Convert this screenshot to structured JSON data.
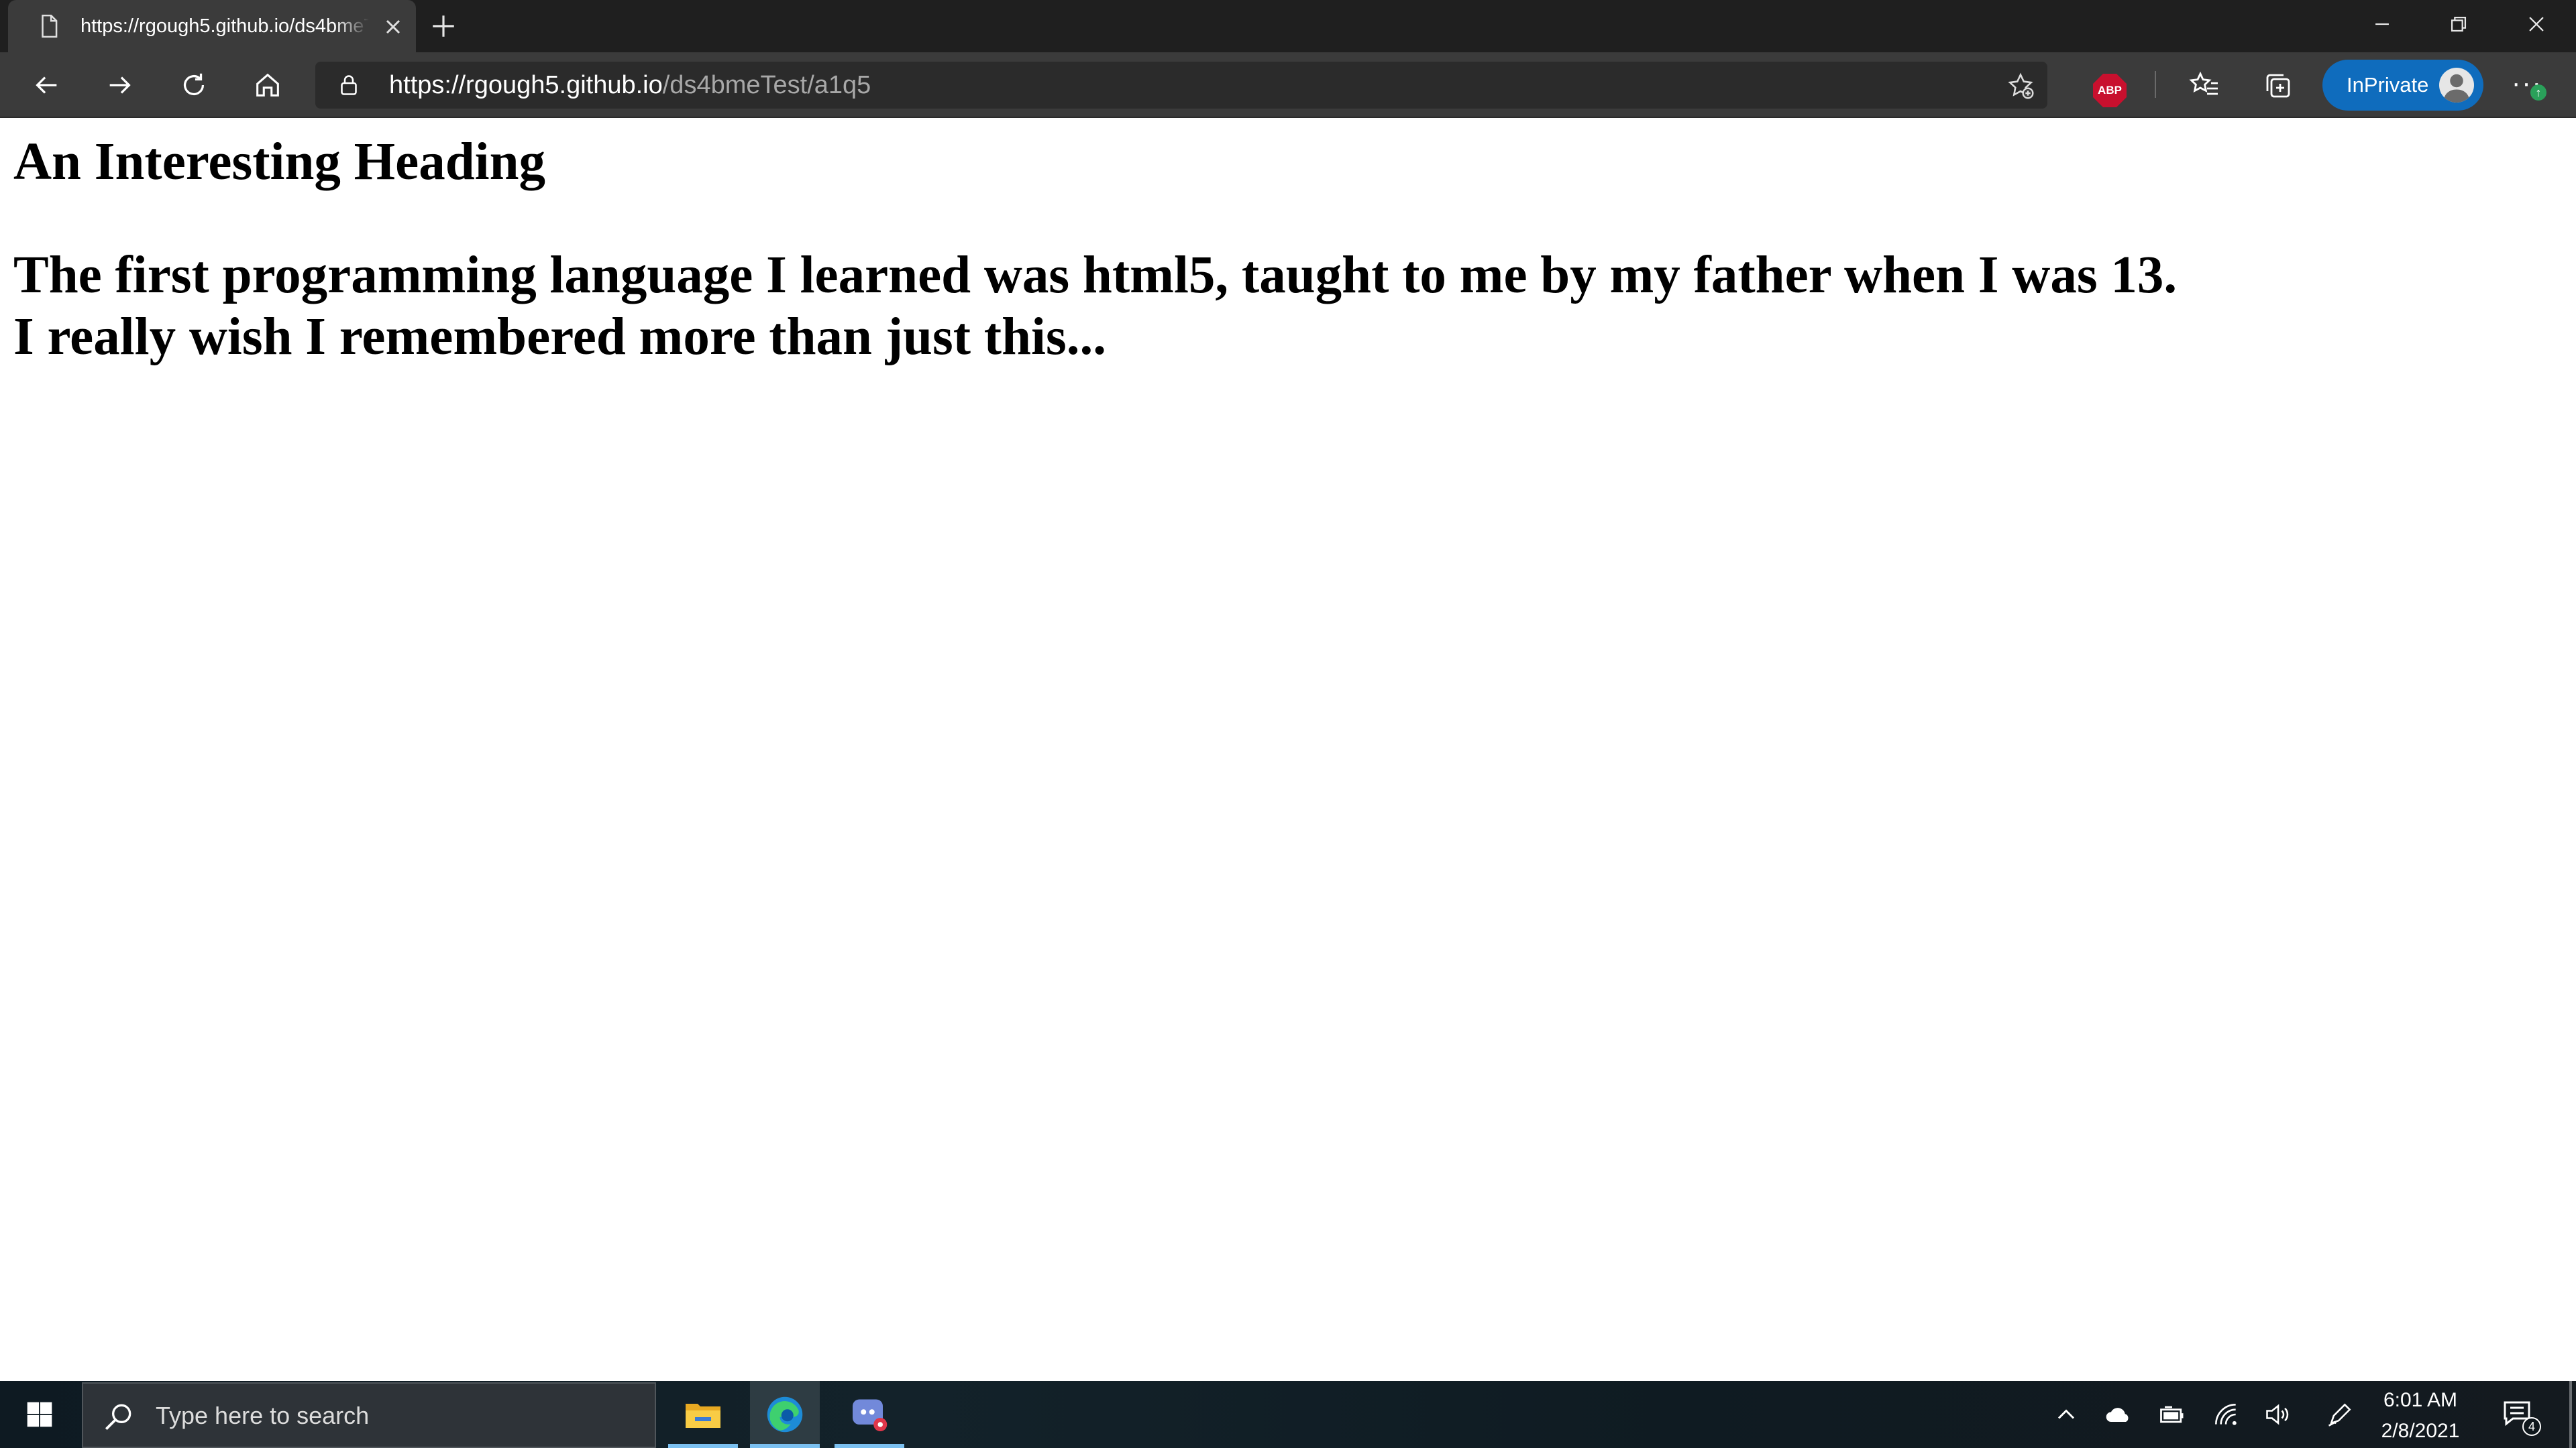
{
  "browser": {
    "tab": {
      "title": "https://rgough5.github.io/ds4bmeTest/a1q5",
      "favicon": "page-icon",
      "close_icon": "close-icon"
    },
    "new_tab_icon": "plus-icon",
    "window_controls": [
      "minimize-icon",
      "restore-icon",
      "close-icon"
    ],
    "address_bar": {
      "host": "https://rgough5.github.io",
      "path": "/ds4bmeTest/a1q5",
      "lock_icon": "lock-icon"
    },
    "nav_icons": [
      "back-icon",
      "forward-icon",
      "refresh-icon",
      "home-icon"
    ],
    "extensions": {
      "abp_label": "ABP"
    },
    "inprivate_label": "InPrivate",
    "menu_badge": "↑"
  },
  "page": {
    "heading": "An Interesting Heading",
    "subheading_line1": "The first programming language I learned was html5, taught to me by my father when I was 13.",
    "subheading_line2": "I really wish I remembered more than just this..."
  },
  "taskbar": {
    "search_placeholder": "Type here to search",
    "apps": [
      "file-explorer-icon",
      "edge-icon",
      "app-icon"
    ],
    "tray_icons": [
      "chevron-up-icon",
      "onedrive-icon",
      "battery-icon",
      "wifi-icon",
      "volume-icon",
      "pen-icon"
    ],
    "clock": {
      "time": "6:01 AM",
      "date": "2/8/2021"
    },
    "notification_count": "4"
  },
  "colors": {
    "tabstrip_bg": "#1f1f1f",
    "toolbar_bg": "#3b3b3b",
    "inprivate_accent": "#0f6cbd",
    "abp_red": "#c8102e"
  }
}
